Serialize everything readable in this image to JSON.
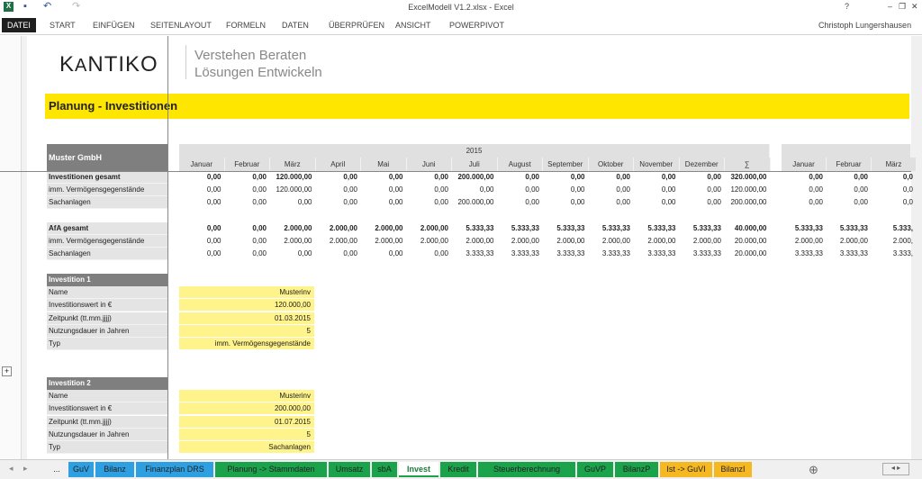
{
  "window": {
    "title": "ExcelModell V1.2.xlsx - Excel",
    "user": "Christoph Lungershausen",
    "help": "?",
    "min": "–",
    "restore": "❐",
    "close": "✕"
  },
  "ribbon": {
    "tabs": [
      "DATEI",
      "START",
      "EINFÜGEN",
      "SEITENLAYOUT",
      "FORMELN",
      "DATEN",
      "ÜBERPRÜFEN",
      "ANSICHT",
      "POWERPIVOT"
    ]
  },
  "logo": {
    "brand": "KANTIKO",
    "tagline1": "Verstehen Beraten",
    "tagline2": "Lösungen Entwickeln"
  },
  "page_title": "Planung - Investitionen",
  "company": "Muster GmbH",
  "year": "2015",
  "months": [
    "Januar",
    "Februar",
    "März",
    "April",
    "Mai",
    "Juni",
    "Juli",
    "August",
    "September",
    "Oktober",
    "November",
    "Dezember",
    "∑"
  ],
  "months_next": [
    "Januar",
    "Februar",
    "März"
  ],
  "rows": [
    {
      "label": "Investitionen gesamt",
      "bold": true,
      "values": [
        "0,00",
        "0,00",
        "120.000,00",
        "0,00",
        "0,00",
        "0,00",
        "200.000,00",
        "0,00",
        "0,00",
        "0,00",
        "0,00",
        "0,00",
        "320.000,00"
      ],
      "next": [
        "0,00",
        "0,00",
        "0,0"
      ]
    },
    {
      "label": "imm. Vermögensgegenstände",
      "values": [
        "0,00",
        "0,00",
        "120.000,00",
        "0,00",
        "0,00",
        "0,00",
        "0,00",
        "0,00",
        "0,00",
        "0,00",
        "0,00",
        "0,00",
        "120.000,00"
      ],
      "next": [
        "0,00",
        "0,00",
        "0,0"
      ]
    },
    {
      "label": "Sachanlagen",
      "values": [
        "0,00",
        "0,00",
        "0,00",
        "0,00",
        "0,00",
        "0,00",
        "200.000,00",
        "0,00",
        "0,00",
        "0,00",
        "0,00",
        "0,00",
        "200.000,00"
      ],
      "next": [
        "0,00",
        "0,00",
        "0,0"
      ]
    },
    {
      "label": "AfA gesamt",
      "bold": true,
      "values": [
        "0,00",
        "0,00",
        "2.000,00",
        "2.000,00",
        "2.000,00",
        "2.000,00",
        "5.333,33",
        "5.333,33",
        "5.333,33",
        "5.333,33",
        "5.333,33",
        "5.333,33",
        "40.000,00"
      ],
      "next": [
        "5.333,33",
        "5.333,33",
        "5.333,"
      ]
    },
    {
      "label": "imm. Vermögensgegenstände",
      "values": [
        "0,00",
        "0,00",
        "2.000,00",
        "2.000,00",
        "2.000,00",
        "2.000,00",
        "2.000,00",
        "2.000,00",
        "2.000,00",
        "2.000,00",
        "2.000,00",
        "2.000,00",
        "20.000,00"
      ],
      "next": [
        "2.000,00",
        "2.000,00",
        "2.000,"
      ]
    },
    {
      "label": "Sachanlagen",
      "values": [
        "0,00",
        "0,00",
        "0,00",
        "0,00",
        "0,00",
        "0,00",
        "3.333,33",
        "3.333,33",
        "3.333,33",
        "3.333,33",
        "3.333,33",
        "3.333,33",
        "20.000,00"
      ],
      "next": [
        "3.333,33",
        "3.333,33",
        "3.333,"
      ]
    }
  ],
  "investments": [
    {
      "title": "Investition 1",
      "fields": [
        {
          "label": "Name",
          "value": "Musterinv"
        },
        {
          "label": "Investitionswert in €",
          "value": "120.000,00"
        },
        {
          "label": "Zeitpunkt (tt.mm.jjjj)",
          "value": "01.03.2015"
        },
        {
          "label": "Nutzungsdauer in  Jahren",
          "value": "5"
        },
        {
          "label": "Typ",
          "value": "imm. Vermögensgegenstände"
        }
      ]
    },
    {
      "title": "Investition 2",
      "fields": [
        {
          "label": "Name",
          "value": "Musterinv"
        },
        {
          "label": "Investitionswert in €",
          "value": "200.000,00"
        },
        {
          "label": "Zeitpunkt (tt.mm.jjjj)",
          "value": "01.07.2015"
        },
        {
          "label": "Nutzungsdauer in  Jahren",
          "value": "5"
        },
        {
          "label": "Typ",
          "value": "Sachanlagen"
        }
      ]
    }
  ],
  "sheet_tabs": [
    {
      "label": "...",
      "color": "#f0f0f0"
    },
    {
      "label": "GuV",
      "color": "#2e9fe0"
    },
    {
      "label": "Bilanz",
      "color": "#2e9fe0"
    },
    {
      "label": "Finanzplan DRS",
      "color": "#2e9fe0"
    },
    {
      "label": "Planung -> Stammdaten",
      "color": "#1aa34a"
    },
    {
      "label": "Umsatz",
      "color": "#1aa34a"
    },
    {
      "label": "sbA",
      "color": "#1aa34a"
    },
    {
      "label": "Invest",
      "color": "#ffffff",
      "active": true
    },
    {
      "label": "Kredit",
      "color": "#1aa34a"
    },
    {
      "label": "Steuerberechnung",
      "color": "#1aa34a"
    },
    {
      "label": "GuVP",
      "color": "#1aa34a"
    },
    {
      "label": "BilanzP",
      "color": "#1aa34a"
    },
    {
      "label": "Ist -> GuVI",
      "color": "#f5b820"
    },
    {
      "label": "BilanzI",
      "color": "#f5b820"
    }
  ],
  "add_sheet": "⊕",
  "outline_button": "+"
}
